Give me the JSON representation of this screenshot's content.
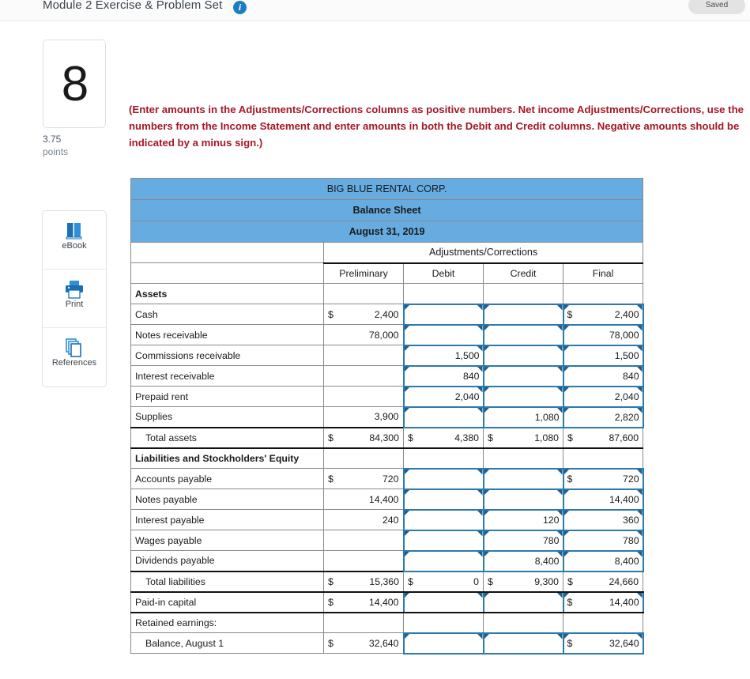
{
  "header": {
    "title": "Module 2 Exercise & Problem Set",
    "info_icon": "info-icon",
    "saved_label": "Saved"
  },
  "question": {
    "number": "8",
    "points_value": "3.75",
    "points_label": "points"
  },
  "tools": [
    {
      "label": "eBook",
      "icon": "book-icon"
    },
    {
      "label": "Print",
      "icon": "printer-icon"
    },
    {
      "label": "References",
      "icon": "copy-pages-icon"
    }
  ],
  "instructions": "(Enter amounts in the Adjustments/Corrections columns as positive numbers. Net income Adjustments/Corrections, use the numbers from the Income Statement and enter amounts in both the Debit and Credit columns. Negative amounts should be indicated by a minus sign.)",
  "colors": {
    "header_blue": "#66ace0",
    "input_border": "#2c79ab",
    "instruction_red": "#a41725",
    "accent_blue": "#1b7ec1"
  },
  "sheet": {
    "title_lines": [
      "BIG BLUE RENTAL CORP.",
      "Balance Sheet",
      "August 31, 2019"
    ],
    "group_header": "Adjustments/Corrections",
    "column_headers": [
      "",
      "Preliminary",
      "Debit",
      "Credit",
      "Final"
    ],
    "rows": [
      {
        "label": "Assets",
        "kind": "section",
        "prelim": {},
        "debit": {},
        "credit": {},
        "final": {}
      },
      {
        "label": "Cash",
        "kind": "item",
        "prelim": {
          "cur": "$",
          "amt": "2,400"
        },
        "debit": {
          "input": true
        },
        "credit": {
          "input": true
        },
        "final": {
          "input": true,
          "cur": "$",
          "amt": "2,400"
        }
      },
      {
        "label": "Notes receivable",
        "kind": "item",
        "prelim": {
          "amt": "78,000"
        },
        "debit": {
          "input": true
        },
        "credit": {
          "input": true
        },
        "final": {
          "input": true,
          "amt": "78,000"
        }
      },
      {
        "label": "Commissions receivable",
        "kind": "item",
        "prelim": {},
        "debit": {
          "input": true,
          "amt": "1,500"
        },
        "credit": {
          "input": true
        },
        "final": {
          "input": true,
          "amt": "1,500"
        }
      },
      {
        "label": "Interest receivable",
        "kind": "item",
        "prelim": {},
        "debit": {
          "input": true,
          "amt": "840"
        },
        "credit": {
          "input": true
        },
        "final": {
          "input": true,
          "amt": "840"
        }
      },
      {
        "label": "Prepaid rent",
        "kind": "item",
        "prelim": {},
        "debit": {
          "input": true,
          "amt": "2,040"
        },
        "credit": {
          "input": true
        },
        "final": {
          "input": true,
          "amt": "2,040"
        }
      },
      {
        "label": "Supplies",
        "kind": "item",
        "prelim": {
          "amt": "3,900"
        },
        "debit": {
          "input": true
        },
        "credit": {
          "input": true,
          "amt": "1,080"
        },
        "final": {
          "input": true,
          "amt": "2,820"
        }
      },
      {
        "label": "Total assets",
        "kind": "total",
        "prelim": {
          "cur": "$",
          "amt": "84,300"
        },
        "debit": {
          "cur": "$",
          "amt": "4,380"
        },
        "credit": {
          "cur": "$",
          "amt": "1,080"
        },
        "final": {
          "cur": "$",
          "amt": "87,600"
        }
      },
      {
        "label": "Liabilities and Stockholders' Equity",
        "kind": "section",
        "prelim": {},
        "debit": {},
        "credit": {},
        "final": {}
      },
      {
        "label": "Accounts payable",
        "kind": "item",
        "prelim": {
          "cur": "$",
          "amt": "720"
        },
        "debit": {
          "input": true
        },
        "credit": {
          "input": true
        },
        "final": {
          "input": true,
          "cur": "$",
          "amt": "720"
        }
      },
      {
        "label": "Notes payable",
        "kind": "item",
        "prelim": {
          "amt": "14,400"
        },
        "debit": {
          "input": true
        },
        "credit": {
          "input": true
        },
        "final": {
          "input": true,
          "amt": "14,400"
        }
      },
      {
        "label": "Interest payable",
        "kind": "item",
        "prelim": {
          "amt": "240"
        },
        "debit": {
          "input": true
        },
        "credit": {
          "input": true,
          "amt": "120"
        },
        "final": {
          "input": true,
          "amt": "360"
        }
      },
      {
        "label": "Wages payable",
        "kind": "item",
        "prelim": {},
        "debit": {
          "input": true
        },
        "credit": {
          "input": true,
          "amt": "780"
        },
        "final": {
          "input": true,
          "amt": "780"
        }
      },
      {
        "label": "Dividends payable",
        "kind": "item",
        "prelim": {},
        "debit": {
          "input": true
        },
        "credit": {
          "input": true,
          "amt": "8,400"
        },
        "final": {
          "input": true,
          "amt": "8,400"
        }
      },
      {
        "label": "Total liabilities",
        "kind": "total",
        "prelim": {
          "cur": "$",
          "amt": "15,360"
        },
        "debit": {
          "cur": "$",
          "amt": "0"
        },
        "credit": {
          "cur": "$",
          "amt": "9,300"
        },
        "final": {
          "cur": "$",
          "amt": "24,660"
        }
      },
      {
        "label": "Paid-in capital",
        "kind": "item-rule",
        "prelim": {
          "cur": "$",
          "amt": "14,400"
        },
        "debit": {
          "input": true
        },
        "credit": {
          "input": true
        },
        "final": {
          "input": true,
          "cur": "$",
          "amt": "14,400"
        }
      },
      {
        "label": "Retained earnings:",
        "kind": "item",
        "prelim": {},
        "debit": {},
        "credit": {},
        "final": {}
      },
      {
        "label": "Balance, August 1",
        "kind": "indent",
        "prelim": {
          "cur": "$",
          "amt": "32,640"
        },
        "debit": {
          "input": true
        },
        "credit": {
          "input": true
        },
        "final": {
          "input": true,
          "cur": "$",
          "amt": "32,640"
        }
      }
    ]
  }
}
